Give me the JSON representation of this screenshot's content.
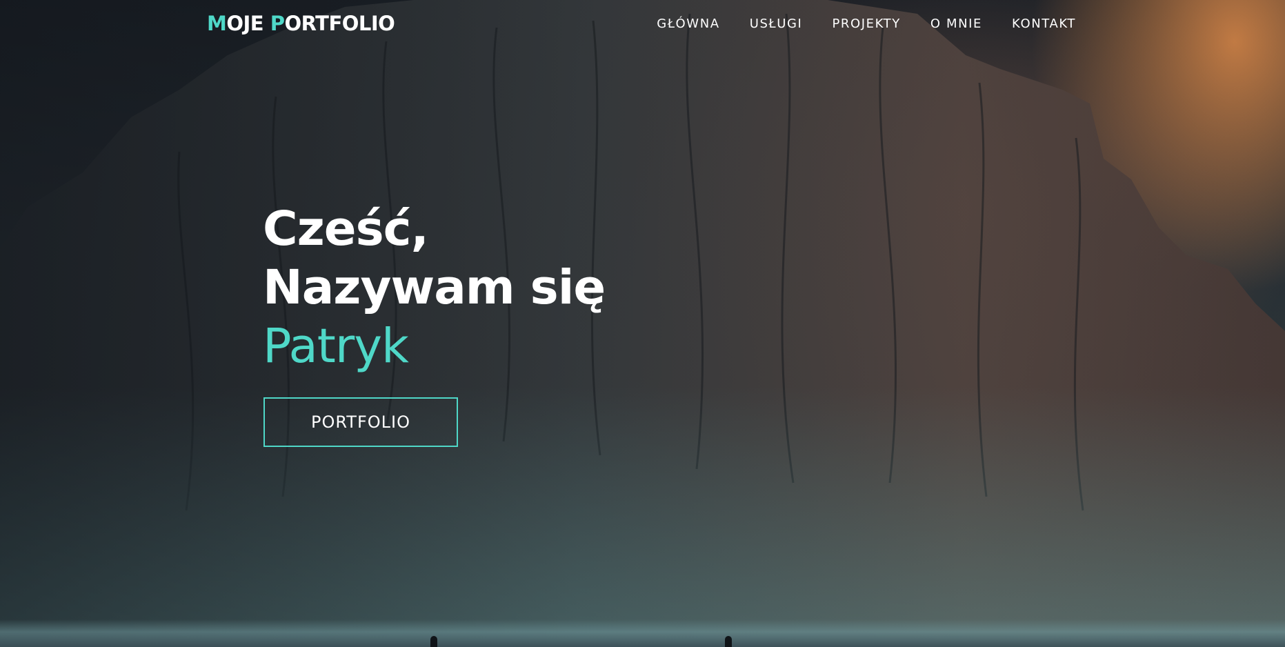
{
  "navbar": {
    "logo_first_letter": "M",
    "logo_rest_1": "OJE ",
    "logo_second_letter": "P",
    "logo_rest_2": "ORTFOLIO",
    "links": [
      {
        "label": "GŁÓWNA"
      },
      {
        "label": "USŁUGI"
      },
      {
        "label": "PROJEKTY"
      },
      {
        "label": "O MNIE"
      },
      {
        "label": "KONTAKT"
      }
    ]
  },
  "hero": {
    "greeting": "Cześć,",
    "intro": "Nazywam się",
    "name": "Patryk",
    "button_label": "PORTFOLIO"
  },
  "colors": {
    "accent": "#4fd8c8",
    "text": "#ffffff",
    "sky_glow": "#d68648"
  }
}
